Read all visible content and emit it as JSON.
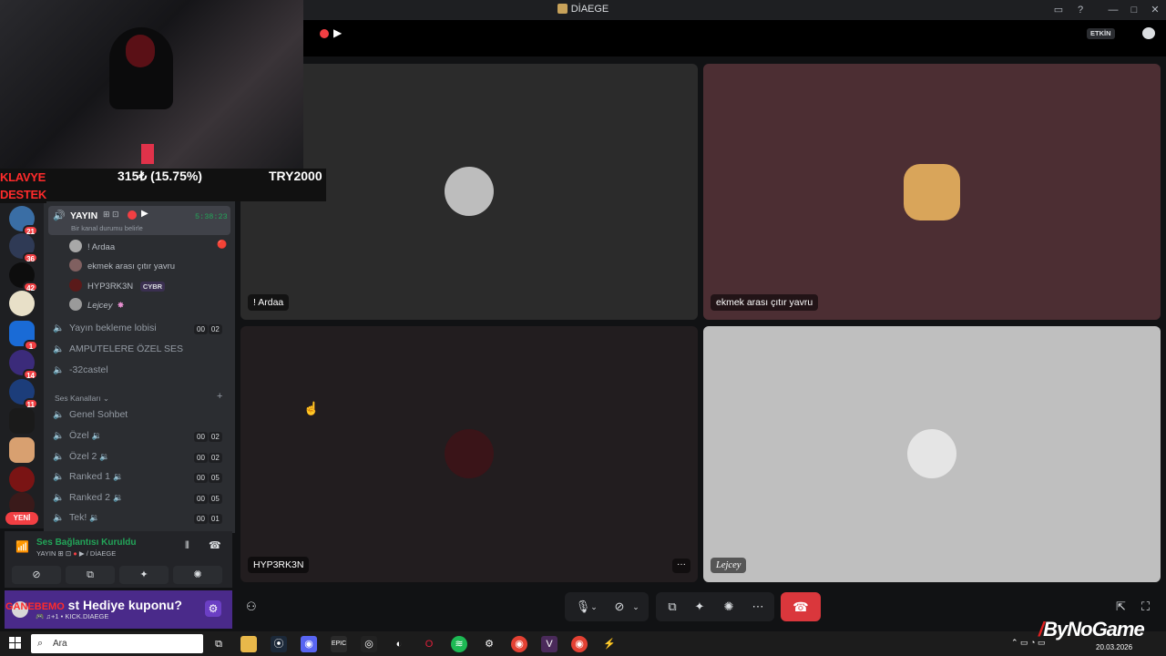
{
  "window": {
    "title": "DİAEGE",
    "help_glyph": "?",
    "minimize_glyph": "—",
    "maximize_glyph": "□",
    "close_glyph": "✕"
  },
  "overlay": {
    "left_line1": "KLAVYE",
    "left_line2": "DESTEK",
    "middle": "315₺ (15.75%)",
    "right": "TRY2000",
    "promo_prefix": "GANEBEMO",
    "promo_text": "Hediye kuponu?",
    "promo_mid": "st"
  },
  "topbar": {
    "status_badge": "ETKİN"
  },
  "servers": [
    {
      "badge": "21",
      "color": "#3a6ea5"
    },
    {
      "badge": "36",
      "color": "#2f3a55"
    },
    {
      "badge": "42",
      "color": "#0d0d0d"
    },
    {
      "badge": "",
      "color": "#e8e0c8"
    },
    {
      "badge": "1",
      "color": "#1a6bd6"
    },
    {
      "badge": "14",
      "color": "#3b2b7a"
    },
    {
      "badge": "11",
      "color": "#1c3d7a"
    },
    {
      "badge": "",
      "color": "#1a1a1a"
    },
    {
      "badge": "",
      "color": "#d8a070"
    },
    {
      "badge": "",
      "color": "#7a1414"
    },
    {
      "badge": "",
      "color": "#3a1a1a"
    }
  ],
  "new_badge": "YENİ",
  "active_channel": {
    "name": "YAYIN",
    "timer": "5:38:23",
    "status_hint": "Bir kanal durumu belirle"
  },
  "channel_members": [
    {
      "name": "! Ardaa",
      "color": "#a8a8a8"
    },
    {
      "name": "ekmek arası çıtır yavru",
      "color": "#806060"
    },
    {
      "name": "HYP3RK3N",
      "color": "#5a1a1a",
      "tag": "CYBR"
    },
    {
      "name": "Lejcey",
      "color": "#9a9a9a"
    }
  ],
  "channels": [
    {
      "name": "Yayın bekleme lobisi",
      "counts": [
        "00",
        "02"
      ]
    },
    {
      "name": "AMPUTELERE ÖZEL SES",
      "counts": []
    },
    {
      "name": "-32castel",
      "counts": []
    }
  ],
  "category": {
    "name": "Ses Kanalları",
    "add_glyph": "+"
  },
  "voice_channels": [
    {
      "name": "Genel Sohbet",
      "counts": []
    },
    {
      "name": "Özel",
      "counts": [
        "00",
        "02"
      ]
    },
    {
      "name": "Özel 2",
      "counts": [
        "00",
        "02"
      ]
    },
    {
      "name": "Ranked 1",
      "counts": [
        "00",
        "05"
      ]
    },
    {
      "name": "Ranked 2",
      "counts": [
        "00",
        "05"
      ]
    },
    {
      "name": "Tek!",
      "counts": [
        "00",
        "01"
      ]
    }
  ],
  "voice_panel": {
    "status": "Ses Bağlantısı Kuruldu",
    "channel_path": "YAYIN",
    "server": "/ DİAEGE"
  },
  "user_panel": {
    "username": "KICK.DIAEGE"
  },
  "tiles": [
    {
      "name": "! Ardaa",
      "bg": "#2b2b2b",
      "avatar_color": "#bdbdbd"
    },
    {
      "name": "ekmek arası çıtır yavru",
      "bg": "#4c2e33",
      "avatar_color": "#d9a55a"
    },
    {
      "name": "HYP3RK3N",
      "bg": "#221d1f",
      "avatar_color": "#3a1418"
    },
    {
      "name": "Lejcey",
      "bg": "#bfbfbf",
      "avatar_color": "#e5e5e5"
    }
  ],
  "taskbar": {
    "search_placeholder": "Ara",
    "date": "20.03.2026"
  },
  "watermark": {
    "brand": "ByNoGame"
  }
}
